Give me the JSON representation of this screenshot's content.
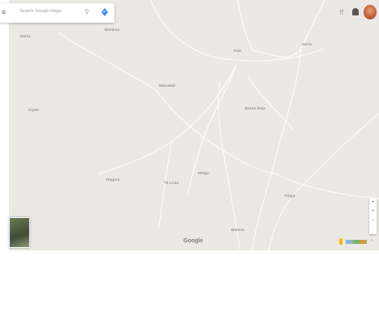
{
  "search": {
    "placeholder": "Search Google Maps"
  },
  "places": [
    {
      "name": "Bamboo"
    },
    {
      "name": "Barra"
    },
    {
      "name": "Fale"
    },
    {
      "name": "Seria"
    },
    {
      "name": "Manukah"
    },
    {
      "name": "Hiyah"
    },
    {
      "name": "Batua Baja"
    },
    {
      "name": "Nagara"
    },
    {
      "name": "Tit Lima"
    },
    {
      "name": "Melgo"
    },
    {
      "name": "Falga"
    },
    {
      "name": "Batana"
    }
  ],
  "attribution": {
    "logo_text": "Google"
  },
  "controls": {
    "zoom_in": "+",
    "zoom_out": "−",
    "apps_glyph": "⠿",
    "expand_glyph": "‹",
    "menu_glyph": "≡",
    "search_glyph": "⚲"
  },
  "colors": {
    "land": "#ebe9e3",
    "road": "#ffffff",
    "direction": "#4285f4"
  }
}
